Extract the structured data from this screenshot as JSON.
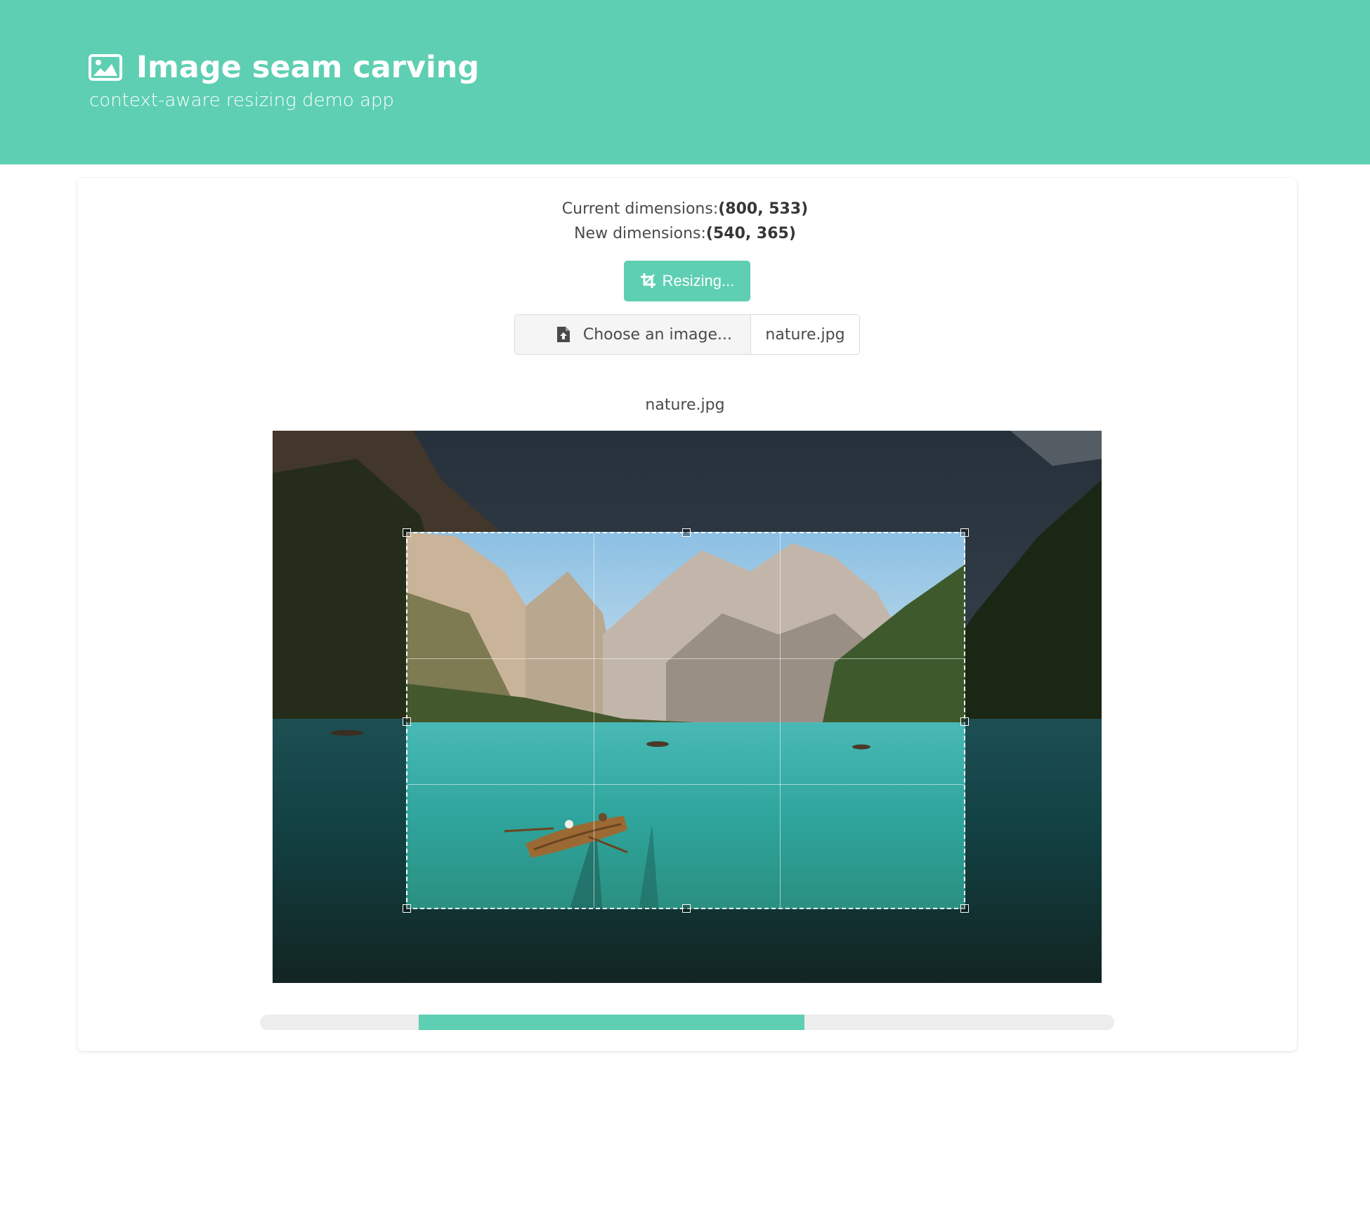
{
  "hero": {
    "title": "Image seam carving",
    "subtitle": "context-aware resizing demo app",
    "icon": "image-icon"
  },
  "dimensions": {
    "current_label": "Current dimensions:",
    "current_value": "(800, 533)",
    "new_label": "New dimensions:",
    "new_value": "(540, 365)"
  },
  "resize_button": {
    "label": "Resizing...",
    "icon": "crop-icon"
  },
  "file_input": {
    "cta_label": "Choose an image...",
    "icon": "file-upload-icon",
    "file_name": "nature.jpg"
  },
  "preview": {
    "caption": "nature.jpg"
  },
  "progress": {
    "start": 0.186,
    "end": 0.637
  },
  "colors": {
    "accent": "#5ecfb2"
  }
}
